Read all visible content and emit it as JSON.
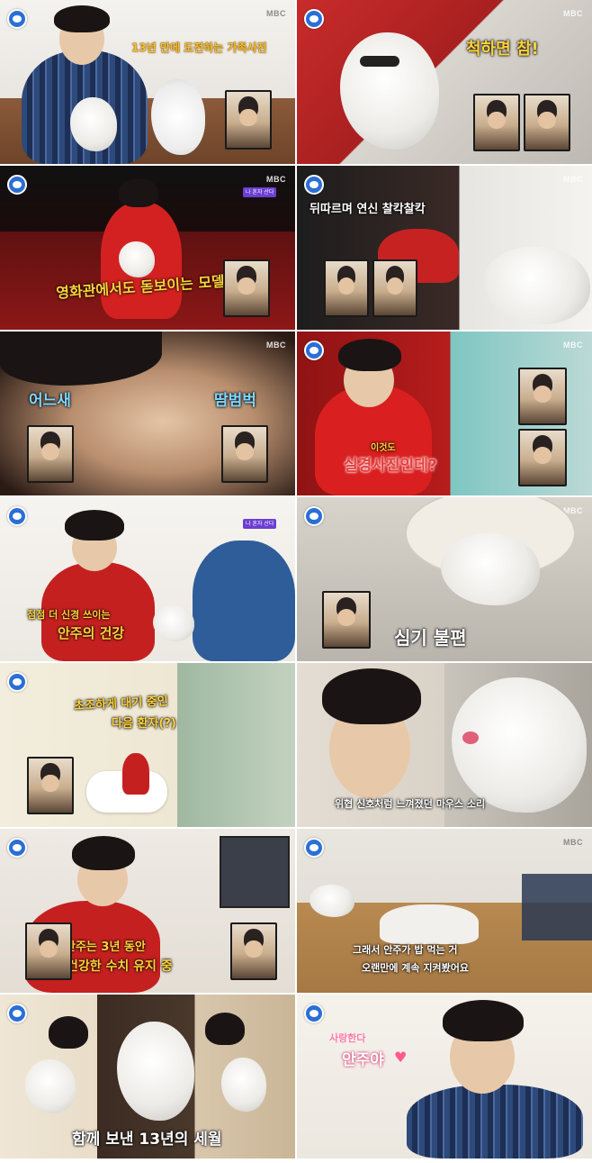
{
  "brand": {
    "watermark": "MBC"
  },
  "panels": [
    {
      "caption": "13년 만에 도전하는 가족사진",
      "caption_color": "#f2c230"
    },
    {
      "caption": "척하면 참!",
      "caption_color": "#ffd23a"
    },
    {
      "caption": "영화관에서도 돋보이는 모델 가족",
      "caption_color": "#ffd23a"
    },
    {
      "caption": "뒤따르며 연신 찰칵찰칵",
      "caption_color": "#ffffff"
    },
    {
      "caption_left": "어느새",
      "caption_right": "땀범벅",
      "caption_color": "#7fd6ff"
    },
    {
      "caption_small": "이것도",
      "caption": "실경사진인데?",
      "caption_color": "#e63b3b"
    },
    {
      "caption_small": "점점 더 신경 쓰이는",
      "caption": "안주의 건강",
      "caption_color": "#ffd23a"
    },
    {
      "caption": "심기 불편",
      "caption_color": "#ffffff"
    },
    {
      "caption_line1": "초조하게 대기 중인",
      "caption_line2": "다음 환자(?)",
      "caption_color": "#ffd23a"
    },
    {
      "caption": "위협 신호처럼 느껴졌던 마우스 소리",
      "caption_color": "#ffffff"
    },
    {
      "caption_line1": "안주는 3년 동안",
      "caption_line2": "건강한 수치 유지 중",
      "caption_color": "#ffd23a"
    },
    {
      "caption_line1": "그래서 안주가 밥 먹는 거",
      "caption_line2": "오랜만에 계속 지켜봤어요",
      "caption_color": "#ffffff"
    },
    {
      "caption": "함께 보낸 13년의 세월",
      "caption_color": "#ffffff"
    },
    {
      "caption_line1": "사랑한다",
      "caption_line2": "안주야",
      "caption_color": "#ff7aa8"
    }
  ],
  "stickers": {
    "text": "나 혼자 산다"
  }
}
